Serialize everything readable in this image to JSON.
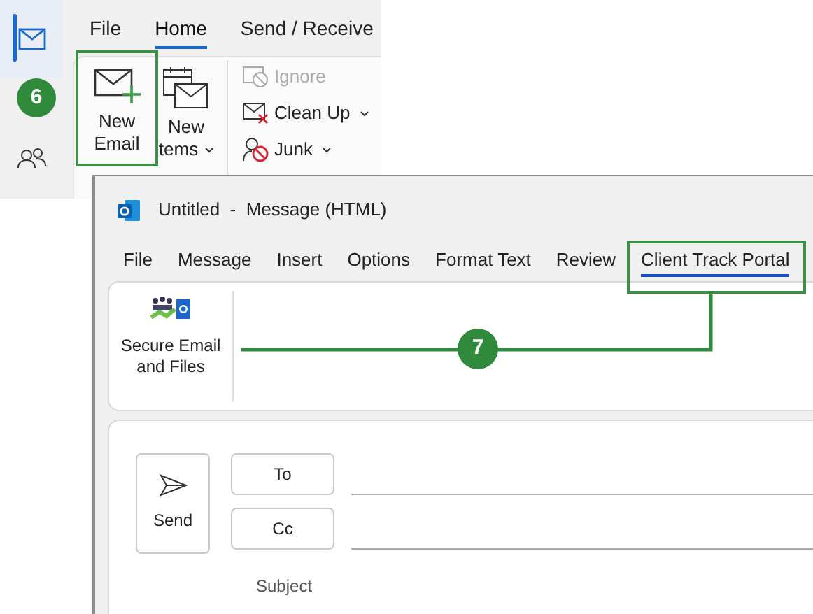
{
  "main_window": {
    "nav": [
      {
        "kind": "mail",
        "selected": true
      },
      {
        "kind": "people",
        "selected": false
      }
    ],
    "tabs": [
      {
        "label": "File",
        "selected": false
      },
      {
        "label": "Home",
        "selected": true
      },
      {
        "label": "Send / Receive",
        "selected": false
      }
    ],
    "large_buttons": [
      {
        "kind": "new-email",
        "lines": [
          "New",
          "Email"
        ],
        "dropdown": false
      },
      {
        "kind": "new-items",
        "lines": [
          "New",
          "tems"
        ],
        "dropdown": true
      }
    ],
    "small_buttons": [
      {
        "kind": "ignore",
        "label": "Ignore",
        "disabled": true,
        "dropdown": false
      },
      {
        "kind": "clean-up",
        "label": "Clean Up",
        "disabled": false,
        "dropdown": true
      },
      {
        "kind": "junk",
        "label": "Junk",
        "disabled": false,
        "dropdown": true
      }
    ]
  },
  "compose_window": {
    "title": "Untitled  -  Message (HTML)",
    "tabs": [
      {
        "label": "File",
        "selected": false
      },
      {
        "label": "Message",
        "selected": false
      },
      {
        "label": "Insert",
        "selected": false
      },
      {
        "label": "Options",
        "selected": false
      },
      {
        "label": "Format Text",
        "selected": false
      },
      {
        "label": "Review",
        "selected": false
      },
      {
        "label": "Client Track Portal",
        "selected": true
      }
    ],
    "ribbon_button": {
      "label": "Secure Email and Files"
    },
    "send": {
      "label": "Send"
    },
    "recipients": [
      {
        "label": "To"
      },
      {
        "label": "Cc"
      }
    ],
    "subject": {
      "label": "Subject"
    }
  },
  "callouts": [
    {
      "label": "6"
    },
    {
      "label": "7"
    }
  ]
}
